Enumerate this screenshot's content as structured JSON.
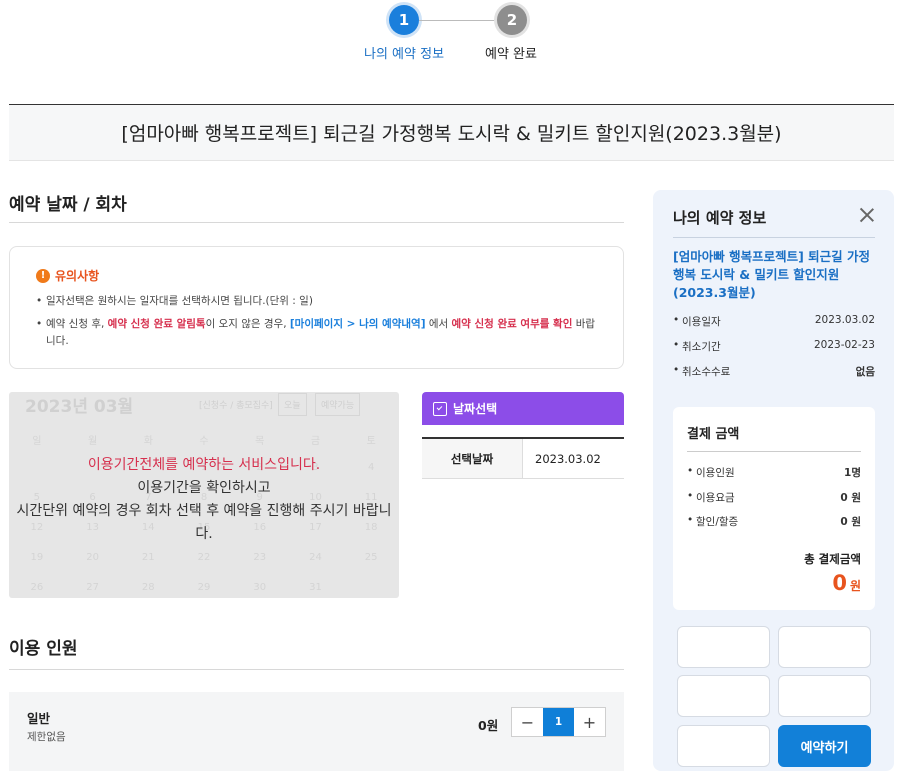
{
  "stepper": {
    "step1_number": "1",
    "step1_label": "나의 예약 정보",
    "step2_number": "2",
    "step2_label": "예약 완료"
  },
  "title": "[엄마아빠 행복프로젝트] 퇴근길 가정행복 도시락 & 밀키트 할인지원(2023.3월분)",
  "date_section": {
    "heading": "예약 날짜 / 회차"
  },
  "notice": {
    "title": "유의사항",
    "item1": "일자선택은 원하시는 일자대를 선택하시면 됩니다.(단위 : 일)",
    "item2_a": "예약 신청 후, ",
    "item2_b": "예약 신청 완료 알림톡",
    "item2_c": "이 오지 않은 경우, ",
    "item2_d": "[마이페이지 > 나의 예약내역]",
    "item2_e": " 에서 ",
    "item2_f": "예약 신청 완료 여부를 확인",
    "item2_g": " 바랍니다."
  },
  "calendar": {
    "month_label": "2023년 03월",
    "legend": "[신청수 / 총모집수]",
    "today_button": "오늘",
    "next_month_button": "예약가능",
    "weekdays": [
      "일",
      "월",
      "화",
      "수",
      "목",
      "금",
      "토"
    ],
    "weeks": [
      [
        "",
        "",
        "",
        "1",
        "2",
        "3",
        "4"
      ],
      [
        "5",
        "6",
        "7",
        "8",
        "9",
        "10",
        "11"
      ],
      [
        "12",
        "13",
        "14",
        "15",
        "16",
        "17",
        "18"
      ],
      [
        "19",
        "20",
        "21",
        "22",
        "23",
        "24",
        "25"
      ],
      [
        "26",
        "27",
        "28",
        "29",
        "30",
        "31",
        ""
      ]
    ],
    "overlay_line1": "이용기간전체를 예약하는 서비스입니다.",
    "overlay_line2": "이용기간을 확인하시고",
    "overlay_line3": "시간단위 예약의 경우 회차 선택 후 예약을 진행해 주시기 바랍니다."
  },
  "date_select": {
    "header": "날짜선택",
    "label": "선택날짜",
    "value": "2023.03.02"
  },
  "people_section": {
    "heading": "이용 인원",
    "row_name": "일반",
    "row_sub": "제한없음",
    "row_price": "0원",
    "qty": "1",
    "minus": "−",
    "plus": "+"
  },
  "sidebar": {
    "title": "나의 예약 정보",
    "product": "[엄마아빠 행복프로젝트] 퇴근길 가정행복 도시락 & 밀키트 할인지원(2023.3월분)",
    "info": [
      {
        "key": "이용일자",
        "value": "2023.03.02"
      },
      {
        "key": "취소기간",
        "value": "2023-02-23"
      },
      {
        "key": "취소수수료",
        "value": "없음"
      }
    ],
    "payment": {
      "title": "결제 금액",
      "rows": [
        {
          "key": "이용인원",
          "value": "1명"
        },
        {
          "key": "이용요금",
          "value": "0 원"
        },
        {
          "key": "할인/할증",
          "value": "0 원"
        }
      ],
      "total_label": "총 결제금액",
      "total_amount": "0",
      "total_unit": "원"
    },
    "reserve_button": "예약하기"
  },
  "colors": {
    "accent_blue": "#1a7fdc",
    "alert_red": "#d6304e",
    "purple_header": "#8c4de8",
    "orange_total": "#e8541e"
  }
}
